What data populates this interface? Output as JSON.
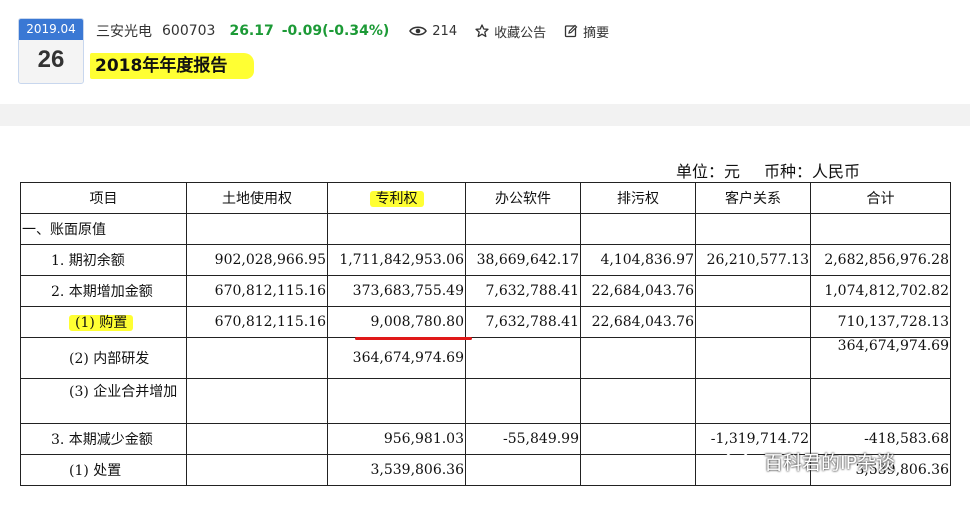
{
  "header": {
    "date_month": "2019.04",
    "date_day": "26",
    "stock_name": "三安光电",
    "stock_code": "600703",
    "price": "26.17",
    "change": "-0.09(-0.34%)",
    "views": "214",
    "favorite_label": "收藏公告",
    "summary_label": "摘要",
    "title": "2018年年度报告"
  },
  "document": {
    "unit_label": "单位：元",
    "currency_label": "币种：人民币",
    "columns": [
      "项目",
      "土地使用权",
      "专利权",
      "办公软件",
      "排污权",
      "客户关系",
      "合计"
    ],
    "rows": [
      [
        "一、账面原值",
        "",
        "",
        "",
        "",
        "",
        ""
      ],
      [
        "1. 期初余额",
        "902,028,966.95",
        "1,711,842,953.06",
        "38,669,642.17",
        "4,104,836.97",
        "26,210,577.13",
        "2,682,856,976.28"
      ],
      [
        "2. 本期增加金额",
        "670,812,115.16",
        "373,683,755.49",
        "7,632,788.41",
        "22,684,043.76",
        "",
        "1,074,812,702.82"
      ],
      [
        "(1) 购置",
        "670,812,115.16",
        "9,008,780.80",
        "7,632,788.41",
        "22,684,043.76",
        "",
        "710,137,728.13"
      ],
      [
        "(2) 内部研发",
        "",
        "364,674,974.69",
        "",
        "",
        "",
        "364,674,974.69"
      ],
      [
        "(3) 企业合并增加",
        "",
        "",
        "",
        "",
        "",
        ""
      ],
      [
        "3. 本期减少金额",
        "",
        "956,981.03",
        "-55,849.99",
        "",
        "-1,319,714.72",
        "-418,583.68"
      ],
      [
        "(1) 处置",
        "",
        "3,539,806.36",
        "",
        "",
        "",
        "3,539,806.36"
      ]
    ]
  },
  "watermark": "百科君的IP杂谈",
  "colors": {
    "accent_blue": "#3a78d4",
    "positive_green": "#1c9a36",
    "highlight": "#ffff33",
    "underline_red": "#e01818"
  }
}
